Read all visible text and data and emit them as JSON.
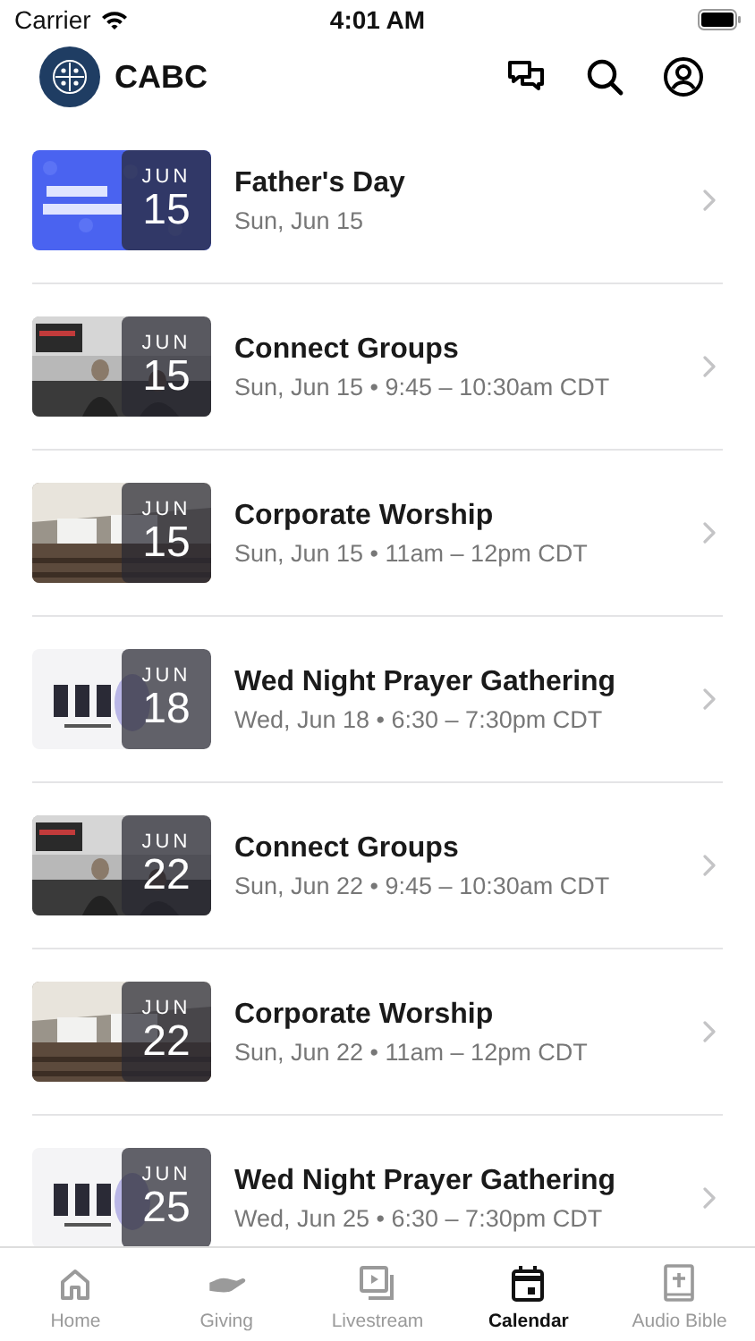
{
  "status_bar": {
    "carrier": "Carrier",
    "time": "4:01 AM"
  },
  "header": {
    "title": "CABC"
  },
  "events": [
    {
      "title": "Father's Day",
      "subtitle": "Sun, Jun 15",
      "month": "JUN",
      "day": "15"
    },
    {
      "title": "Connect Groups",
      "subtitle": "Sun, Jun 15 • 9:45 – 10:30am CDT",
      "month": "JUN",
      "day": "15"
    },
    {
      "title": "Corporate Worship",
      "subtitle": "Sun, Jun 15 • 11am – 12pm CDT",
      "month": "JUN",
      "day": "15"
    },
    {
      "title": "Wed Night Prayer Gathering",
      "subtitle": "Wed, Jun 18 • 6:30 – 7:30pm CDT",
      "month": "JUN",
      "day": "18"
    },
    {
      "title": "Connect Groups",
      "subtitle": "Sun, Jun 22 • 9:45 – 10:30am CDT",
      "month": "JUN",
      "day": "22"
    },
    {
      "title": "Corporate Worship",
      "subtitle": "Sun, Jun 22 • 11am – 12pm CDT",
      "month": "JUN",
      "day": "22"
    },
    {
      "title": "Wed Night Prayer Gathering",
      "subtitle": "Wed, Jun 25 • 6:30 – 7:30pm CDT",
      "month": "JUN",
      "day": "25"
    }
  ],
  "tab_bar": [
    {
      "label": "Home",
      "selected": false
    },
    {
      "label": "Giving",
      "selected": false
    },
    {
      "label": "Livestream",
      "selected": false
    },
    {
      "label": "Calendar",
      "selected": true
    },
    {
      "label": "Audio Bible",
      "selected": false
    }
  ]
}
